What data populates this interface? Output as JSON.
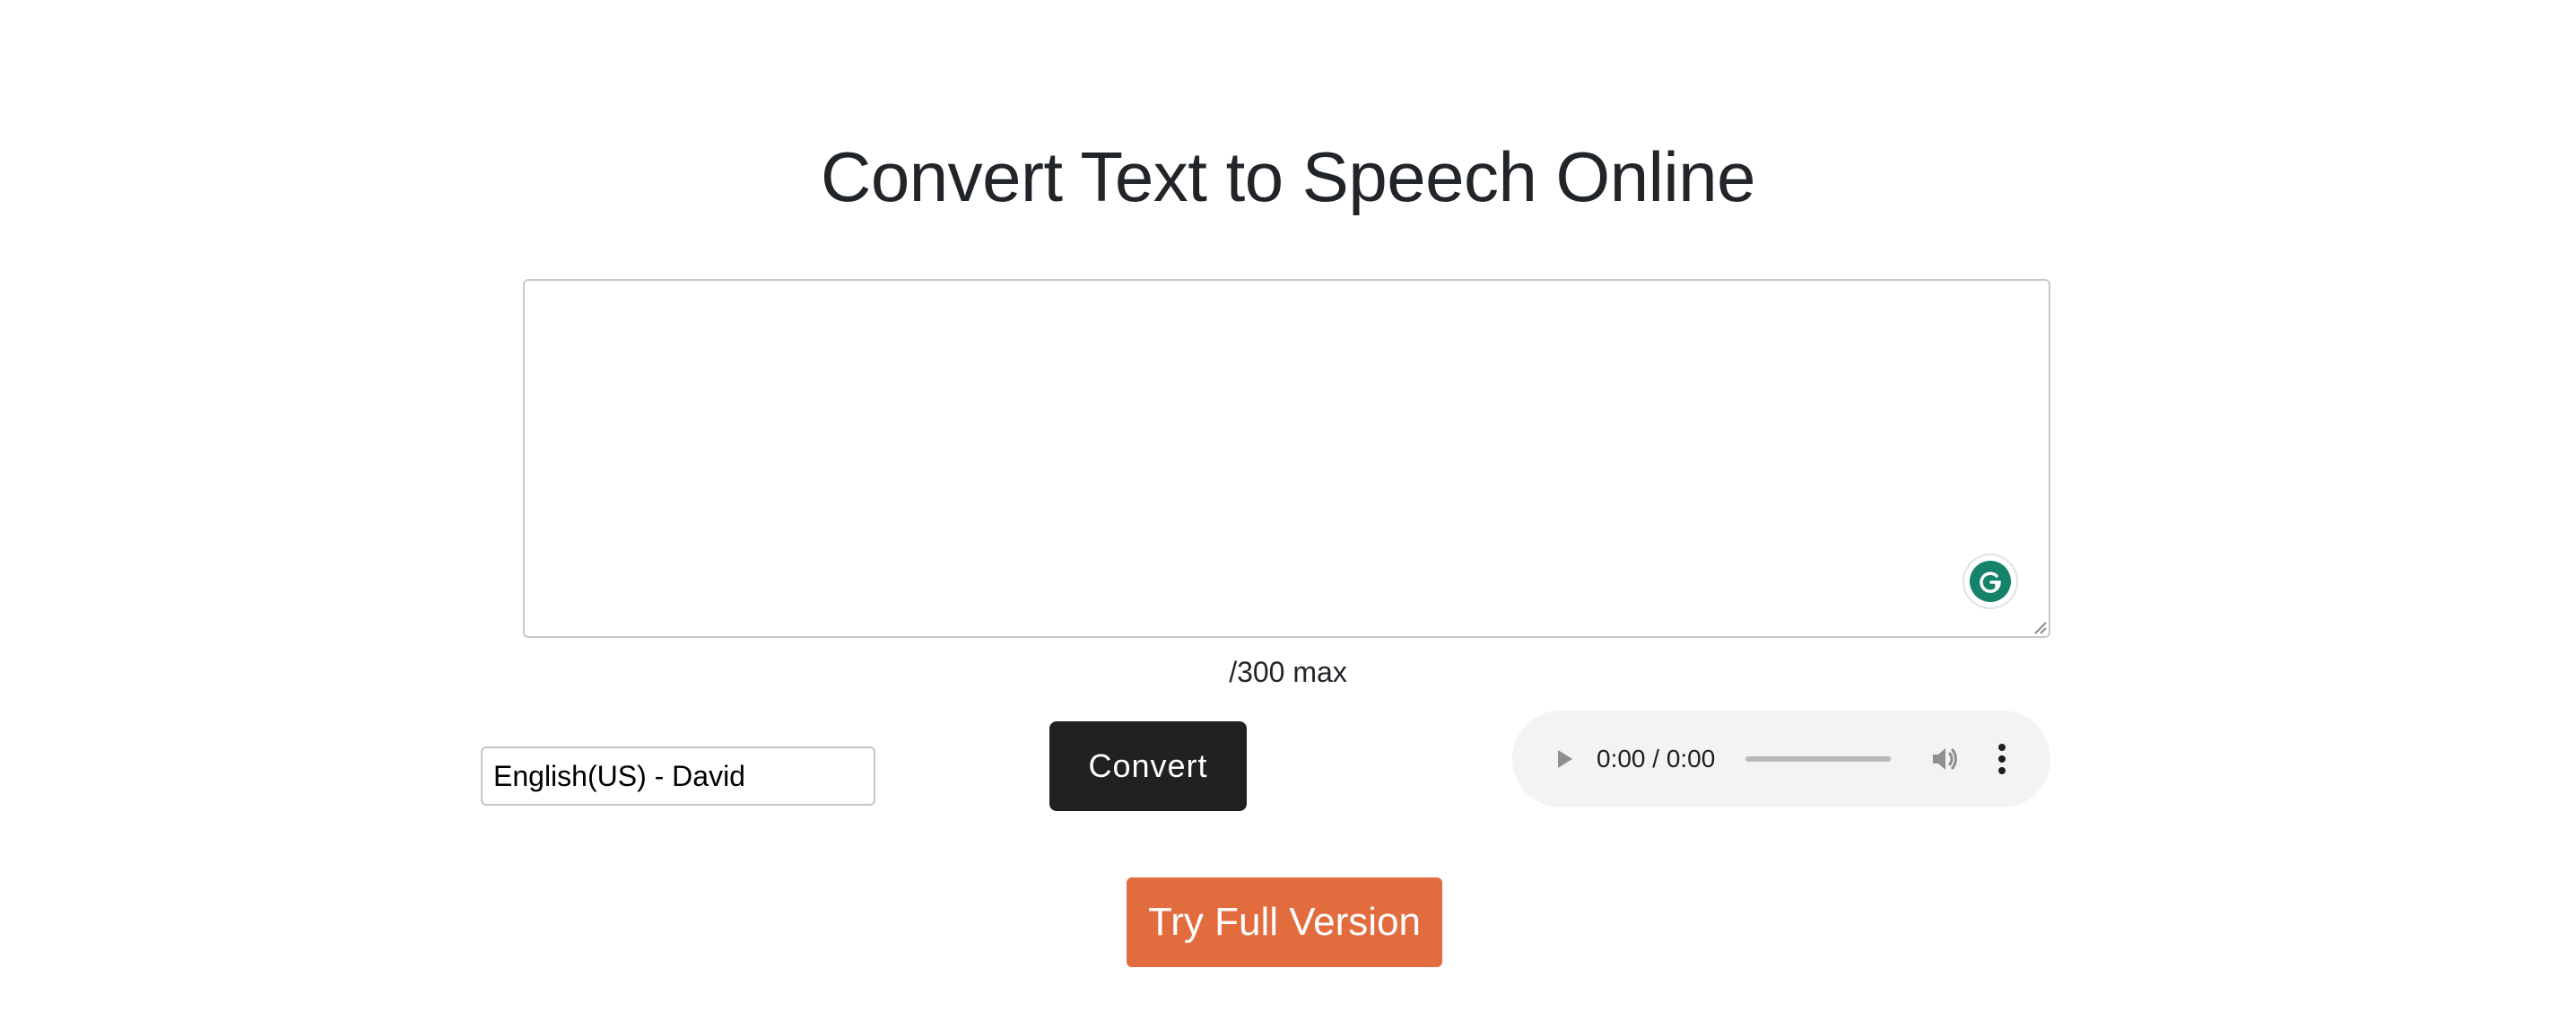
{
  "header": {
    "title": "Convert Text to Speech Online"
  },
  "editor": {
    "text_value": "",
    "counter_label": "/300 max"
  },
  "controls": {
    "voice_selected": "English(US) - David",
    "convert_label": "Convert"
  },
  "audio": {
    "time_display": "0:00 / 0:00",
    "icons": [
      "play-icon",
      "volume-icon",
      "more-options-icon"
    ]
  },
  "cta": {
    "full_version_label": "Try Full Version"
  },
  "colors": {
    "convert_button": "#212121",
    "cta_button": "#e36c3f",
    "grammarly_badge": "#15826a",
    "audio_background": "#f1f3f4"
  }
}
